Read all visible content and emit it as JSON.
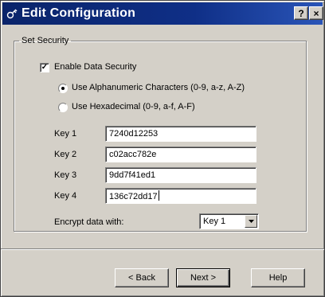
{
  "window": {
    "title": "Edit Configuration",
    "help_glyph": "?",
    "close_glyph": "×"
  },
  "group": {
    "legend": "Set Security",
    "enable_security": {
      "label": "Enable Data Security",
      "checked": true
    },
    "radios": [
      {
        "label": "Use Alphanumeric Characters (0-9, a-z, A-Z)",
        "selected": true
      },
      {
        "label": "Use Hexadecimal (0-9, a-f, A-F)",
        "selected": false
      }
    ],
    "keys": [
      {
        "label": "Key 1",
        "value": "7240d12253"
      },
      {
        "label": "Key 2",
        "value": "c02acc782e"
      },
      {
        "label": "Key 3",
        "value": "9dd7f41ed1"
      },
      {
        "label": "Key 4",
        "value": "136c72dd17"
      }
    ],
    "encrypt": {
      "label": "Encrypt data with:",
      "selected": "Key 1"
    }
  },
  "buttons": {
    "back": "< Back",
    "next": "Next >",
    "help": "Help"
  }
}
